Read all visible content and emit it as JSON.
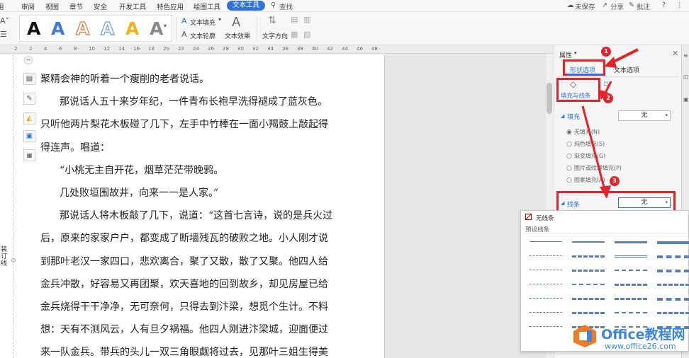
{
  "menu": {
    "tabs": [
      "审阅",
      "视图",
      "章节",
      "安全",
      "开发工具",
      "特色应用",
      "绘图工具",
      "文本工具"
    ],
    "search": "查找",
    "unsaved": "未保存",
    "share": "分享",
    "comment": "批注",
    "help": "?"
  },
  "ribbon": {
    "text_fill": "文本填充",
    "text_outline": "文本轮廓",
    "text_effect": "文本效果",
    "text_direction": "文字方向",
    "style_letter": "A",
    "style_colors": [
      "#111111",
      "#3d78d8",
      "#e8733a",
      "#6b9be0",
      "#f2b21a",
      "#888888"
    ]
  },
  "ruler": {
    "marks": [
      "2",
      "2",
      "4",
      "6",
      "8",
      "10",
      "12",
      "14",
      "16",
      "18",
      "20",
      "22",
      "24",
      "26",
      "28",
      "30",
      "32",
      "34",
      "36",
      "38",
      "40",
      "42",
      "44",
      "46",
      "48"
    ]
  },
  "document": {
    "gutter_label": "装订线",
    "paragraphs": [
      "聚精会神的听着一个瘦削的老者说话。",
      "那说话人五十来岁年纪，一件青布长袍早洗得褪成了蓝灰色。",
      "只听他两片梨花木板碰了几下，左手中竹棒在一面小羯鼓上敲起得",
      "得连声。唱道：",
      "“小桃无主自开花，烟草茫茫带晚鸦。",
      "几处败垣围故井，向来一一是人家。”",
      "那说话人将木板敲了几下，说道：“这首七言诗，说的是兵火过",
      "后，原来的家家户户，都变成了断墙残瓦的破败之地。小人刚才说",
      "到那叶老汉一家四口，悲欢离合，聚了又散，散了又聚。他四人给",
      "金兵冲散，好容易又再团聚，欢天喜地的回到故乡，却见房屋已给",
      "金兵烧得干干净净，无可奈何，只得去到汴梁，想觅个生计。不料",
      "想：天有不测风云，人有旦夕祸福。他四人刚进汴梁城，迎面便过",
      "来一队金兵。带兵的头儿一双三角眼觑将过去，见那叶三姐生得美"
    ]
  },
  "panel": {
    "title": "属性",
    "tab_shape": "形状选项",
    "tab_text": "文本选项",
    "fill_line_label": "填充与线条",
    "fill_section": "填充",
    "fill_value": "无",
    "fill_options": [
      "无填充(N)",
      "纯色填充(S)",
      "渐变填充(G)",
      "图片或纹理填充(P)",
      "图案填充(A)"
    ],
    "line_section": "线条",
    "line_value": "无",
    "badges": [
      "1",
      "2",
      "3"
    ]
  },
  "popup": {
    "no_line": "无线条",
    "preset_label": "预设线条"
  },
  "watermark": {
    "title": "Office教程网",
    "url": "www.office26.com",
    "logo_colors": [
      "#f07b24",
      "#3f86d9"
    ]
  }
}
